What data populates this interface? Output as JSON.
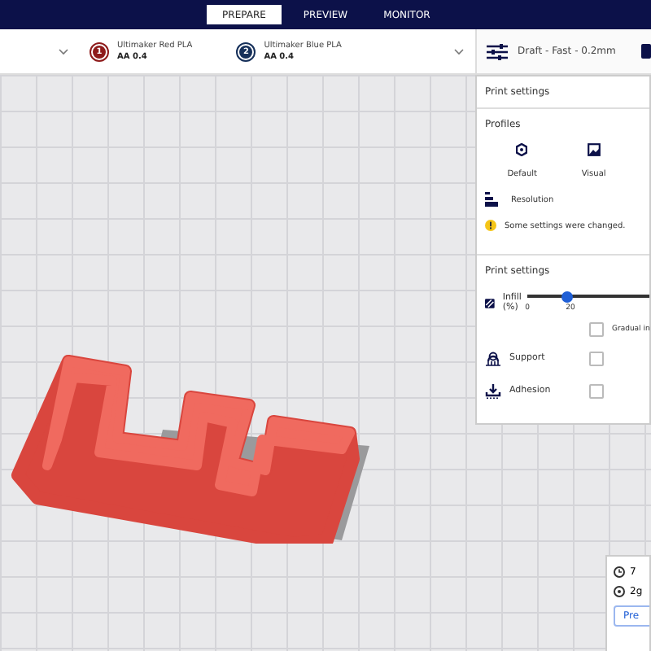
{
  "tabs": [
    {
      "label": "PREPARE",
      "selected": true
    },
    {
      "label": "PREVIEW",
      "selected": false
    },
    {
      "label": "MONITOR",
      "selected": false
    }
  ],
  "extruders": [
    {
      "number": "1",
      "material": "Ultimaker Red PLA",
      "core": "AA 0.4",
      "color": "#8e1b1b"
    },
    {
      "number": "2",
      "material": "Ultimaker Blue PLA",
      "core": "AA 0.4",
      "color": "#16305a"
    }
  ],
  "profile_summary": "Draft - Fast - 0.2mm",
  "panel": {
    "title": "Print settings",
    "profiles_heading": "Profiles",
    "profiles": [
      {
        "label": "Default"
      },
      {
        "label": "Visual"
      }
    ],
    "resolution_label": "Resolution",
    "notice": "Some settings were changed.",
    "settings_heading": "Print settings",
    "settings": [
      {
        "kind": "slider",
        "label": "Infill (%)",
        "ticks": [
          "0",
          "20"
        ],
        "level": 0.2,
        "checkbox_label": "Gradual in",
        "checked": false
      },
      {
        "kind": "checkbox",
        "label": "Support",
        "checked": false
      },
      {
        "kind": "checkbox",
        "label": "Adhesion",
        "checked": false
      }
    ]
  },
  "estimate": {
    "time": "7",
    "weight": "2g",
    "button": "Pre"
  }
}
